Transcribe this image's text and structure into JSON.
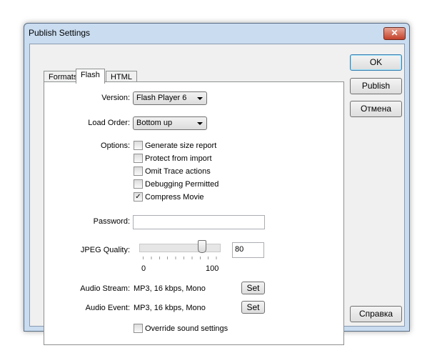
{
  "window": {
    "title": "Publish Settings",
    "close": "✕"
  },
  "tabs": [
    {
      "label": "Formats"
    },
    {
      "label": "Flash"
    },
    {
      "label": "HTML"
    }
  ],
  "flash": {
    "version_label": "Version:",
    "version_value": "Flash Player 6",
    "load_order_label": "Load Order:",
    "load_order_value": "Bottom up",
    "options_label": "Options:",
    "options": [
      {
        "label": "Generate size report",
        "checked": false
      },
      {
        "label": "Protect from import",
        "checked": false
      },
      {
        "label": "Omit Trace actions",
        "checked": false
      },
      {
        "label": "Debugging Permitted",
        "checked": false
      },
      {
        "label": "Compress Movie",
        "checked": true
      }
    ],
    "password_label": "Password:",
    "password_value": "",
    "jpeg_label": "JPEG Quality:",
    "jpeg_value": "80",
    "jpeg_min": "0",
    "jpeg_max": "100",
    "audio_stream_label": "Audio Stream:",
    "audio_stream_value": "MP3, 16 kbps, Mono",
    "audio_event_label": "Audio Event:",
    "audio_event_value": "MP3, 16 kbps, Mono",
    "set_label": "Set",
    "override_label": "Override sound settings"
  },
  "buttons": {
    "ok": "OK",
    "publish": "Publish",
    "cancel": "Отмена",
    "help": "Справка"
  }
}
